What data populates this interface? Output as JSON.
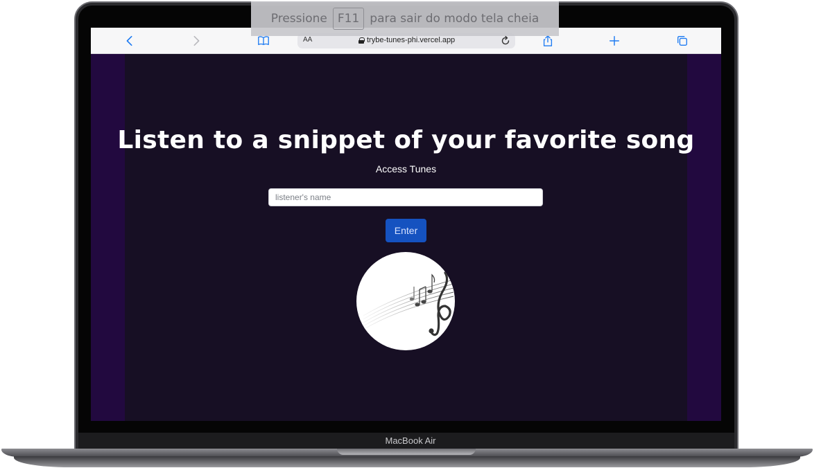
{
  "overlay": {
    "fullscreen_before": "Pressione",
    "fullscreen_key": "F11",
    "fullscreen_after": "para sair do modo tela cheia"
  },
  "browser": {
    "reader_label": "AA",
    "url": "trybe-tunes-phi.vercel.app",
    "icons": [
      "chevron-left-icon",
      "chevron-right-icon",
      "book-icon",
      "lock-icon",
      "reload-icon",
      "share-icon",
      "plus-icon",
      "tabs-icon"
    ],
    "accent_color": "#1e7bf2"
  },
  "page": {
    "headline": "Listen to a snippet of your favorite song",
    "subtitle": "Access Tunes",
    "name_placeholder": "listener's name",
    "enter_label": "Enter",
    "colors": {
      "background": "#170f24",
      "side_panels": "#22093f",
      "button": "#1552c0"
    }
  },
  "device": {
    "label": "MacBook Air"
  }
}
